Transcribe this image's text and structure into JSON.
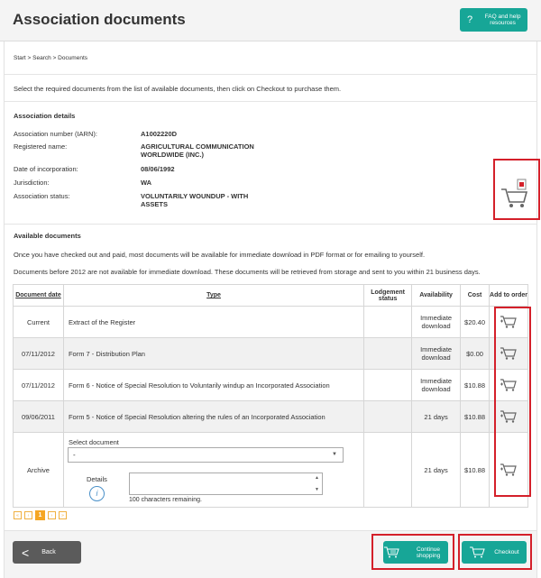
{
  "header": {
    "title": "Association documents",
    "faq_label": "FAQ and help resources"
  },
  "breadcrumb": "Start > Search > Documents",
  "intro": "Select the required documents from the list of available documents, then click on Checkout to purchase them.",
  "association": {
    "section_title": "Association details",
    "fields": [
      {
        "label": "Association number (IARN):",
        "value": "A1002220D"
      },
      {
        "label": "Registered name:",
        "value": "AGRICULTURAL COMMUNICATION WORLDWIDE (INC.)"
      },
      {
        "label": "Date of incorporation:",
        "value": "08/06/1992"
      },
      {
        "label": "Jurisdiction:",
        "value": "WA"
      },
      {
        "label": "Association status:",
        "value": "VOLUNTARILY WOUNDUP - WITH ASSETS"
      }
    ]
  },
  "available": {
    "section_title": "Available documents",
    "note1": "Once you have checked out and paid, most documents will be available for immediate download in PDF format or for emailing to yourself.",
    "note2": "Documents before 2012 are not available for immediate download. These documents will be retrieved from storage and sent to you within 21 business days."
  },
  "table": {
    "headers": [
      "Document date",
      "Type",
      "Lodgement status",
      "Availability",
      "Cost",
      "Add to order"
    ],
    "rows": [
      {
        "date": "Current",
        "type": "Extract of the Register",
        "status": "",
        "availability": "Immediate download",
        "cost": "$20.40"
      },
      {
        "date": "07/11/2012",
        "type": "Form 7 - Distribution Plan",
        "status": "",
        "availability": "Immediate download",
        "cost": "$0.00"
      },
      {
        "date": "07/11/2012",
        "type": "Form 6 - Notice of Special Resolution to Voluntarily windup an Incorporated Association",
        "status": "",
        "availability": "Immediate download",
        "cost": "$10.88"
      },
      {
        "date": "09/06/2011",
        "type": "Form 5 - Notice of Special Resolution altering the rules of an Incorporated Association",
        "status": "",
        "availability": "21 days",
        "cost": "$10.88"
      },
      {
        "date": "Archive",
        "type": "",
        "status": "",
        "availability": "21 days",
        "cost": "$10.88"
      }
    ],
    "archive": {
      "select_label": "Select document",
      "select_value": "-",
      "details_label": "Details",
      "chars_remaining": "100 characters remaining."
    }
  },
  "pager": {
    "first": "«",
    "prev": "‹",
    "current": "1",
    "next": "›",
    "last": "»"
  },
  "footer": {
    "back": "Back",
    "continue": "Continue shopping",
    "checkout": "Checkout"
  },
  "colors": {
    "accent": "#17a697",
    "highlight": "#d4202a",
    "pager": "#f5a623",
    "back": "#5b5b5b"
  }
}
